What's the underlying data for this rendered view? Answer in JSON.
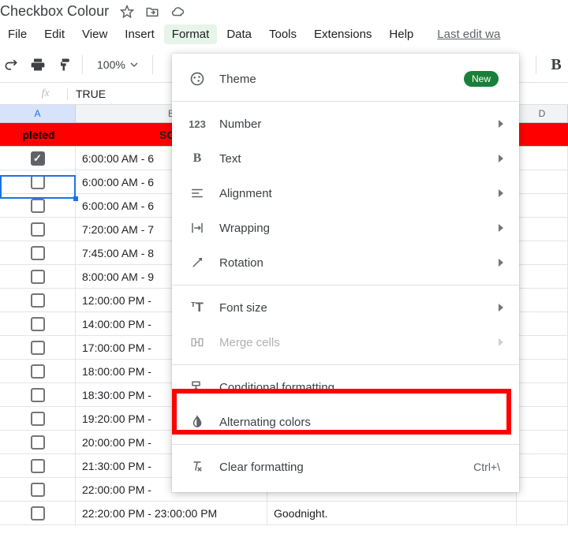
{
  "doc_title": "Checkbox Colour",
  "menubar": {
    "file": "File",
    "edit": "Edit",
    "view": "View",
    "insert": "Insert",
    "format": "Format",
    "data": "Data",
    "tools": "Tools",
    "extensions": "Extensions",
    "help": "Help",
    "last_edit": "Last edit wa"
  },
  "toolbar": {
    "zoom": "100%",
    "bold": "B"
  },
  "formula": {
    "fx_label": "fx",
    "value": "TRUE"
  },
  "columns": {
    "a": "A",
    "b": "B",
    "d": "D"
  },
  "sheet_headers": {
    "completed": "pleted",
    "schedule": "SCHE"
  },
  "rows": [
    {
      "checked": true,
      "time": "6:00:00 AM - 6",
      "desc": ""
    },
    {
      "checked": false,
      "time": "6:00:00 AM - 6",
      "desc": ""
    },
    {
      "checked": false,
      "time": "6:00:00 AM - 6",
      "desc": ""
    },
    {
      "checked": false,
      "time": "7:20:00 AM - 7",
      "desc": ""
    },
    {
      "checked": false,
      "time": "7:45:00 AM - 8",
      "desc": ""
    },
    {
      "checked": false,
      "time": "8:00:00 AM - 9",
      "desc": ""
    },
    {
      "checked": false,
      "time": "12:00:00 PM -",
      "desc": ""
    },
    {
      "checked": false,
      "time": "14:00:00 PM -",
      "desc": ""
    },
    {
      "checked": false,
      "time": "17:00:00 PM -",
      "desc": ""
    },
    {
      "checked": false,
      "time": "18:00:00 PM -",
      "desc": ""
    },
    {
      "checked": false,
      "time": "18:30:00 PM -",
      "desc": ""
    },
    {
      "checked": false,
      "time": "19:20:00 PM -",
      "desc": ""
    },
    {
      "checked": false,
      "time": "20:00:00 PM -",
      "desc": ""
    },
    {
      "checked": false,
      "time": "21:30:00 PM -",
      "desc": ""
    },
    {
      "checked": false,
      "time": "22:00:00 PM -",
      "desc": ""
    },
    {
      "checked": false,
      "time": "22:20:00 PM - 23:00:00 PM",
      "desc": "Goodnight."
    }
  ],
  "dropdown": {
    "theme": "Theme",
    "new_badge": "New",
    "number": "Number",
    "text": "Text",
    "alignment": "Alignment",
    "wrapping": "Wrapping",
    "rotation": "Rotation",
    "font_size": "Font size",
    "merge": "Merge cells",
    "conditional": "Conditional formatting",
    "alt_colors": "Alternating colors",
    "clear": "Clear formatting",
    "clear_shortcut": "Ctrl+\\"
  }
}
